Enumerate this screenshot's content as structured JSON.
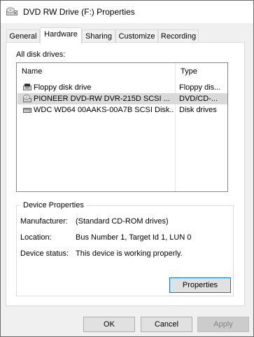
{
  "window": {
    "title": "DVD RW Drive (F:) Properties"
  },
  "tabs": [
    {
      "label": "General"
    },
    {
      "label": "Hardware"
    },
    {
      "label": "Sharing"
    },
    {
      "label": "Customize"
    },
    {
      "label": "Recording"
    }
  ],
  "disk_drives": {
    "label": "All disk drives:",
    "columns": {
      "name": "Name",
      "type": "Type"
    },
    "rows": [
      {
        "name": "Floppy disk drive",
        "type": "Floppy dis...",
        "icon": "floppy-drive-icon"
      },
      {
        "name": "PIONEER DVD-RW  DVR-215D SCSI ...",
        "type": "DVD/CD-...",
        "icon": "dvd-drive-icon",
        "selected": true
      },
      {
        "name": "WDC WD64 00AAKS-00A7B SCSI Disk...",
        "type": "Disk drives",
        "icon": "hard-disk-icon"
      }
    ]
  },
  "device_properties": {
    "title": "Device Properties",
    "manufacturer_label": "Manufacturer:",
    "manufacturer_value": "(Standard CD-ROM drives)",
    "location_label": "Location:",
    "location_value": "Bus Number 1, Target Id 1, LUN 0",
    "status_label": "Device status:",
    "status_value": "This device is working properly.",
    "properties_button": "Properties"
  },
  "buttons": {
    "ok": "OK",
    "cancel": "Cancel",
    "apply": "Apply"
  },
  "colors": {
    "selection": "#d9d9d9",
    "focus_border": "#0078d7",
    "dialog_bg": "#f0f0f0"
  }
}
